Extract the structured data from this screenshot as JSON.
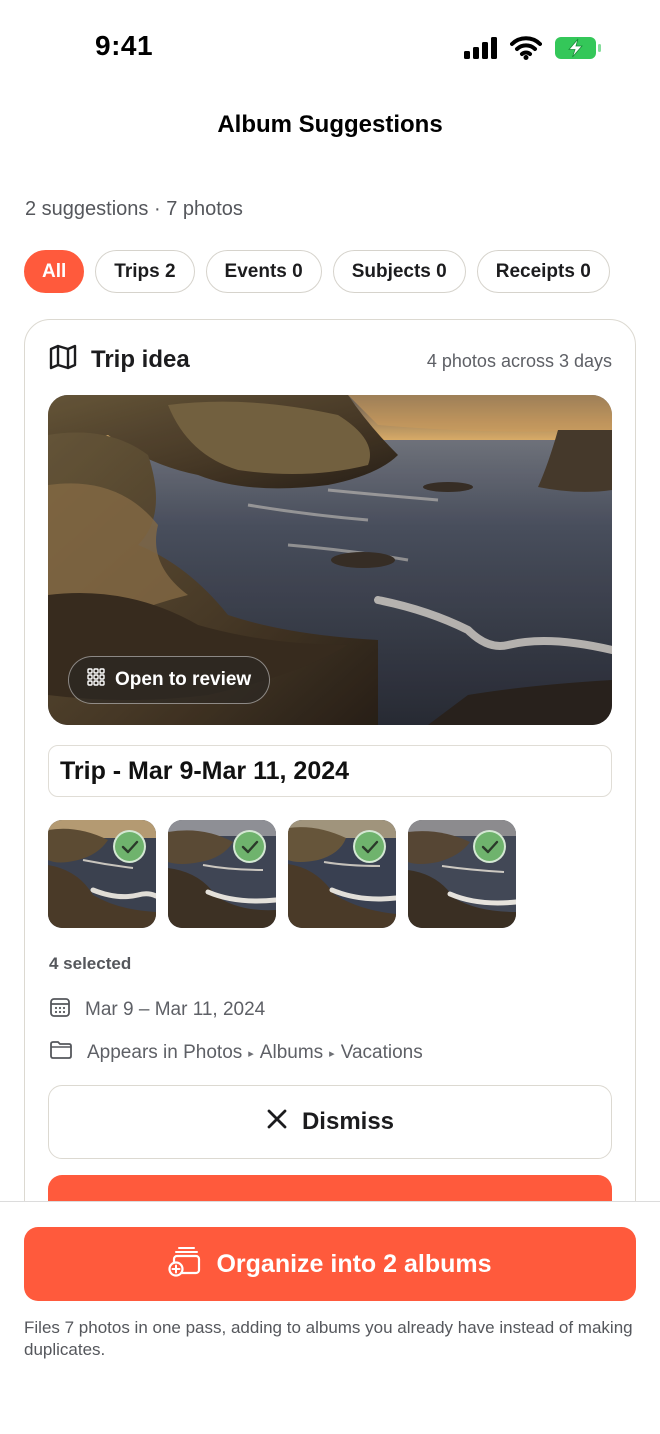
{
  "status": {
    "time": "9:41"
  },
  "nav": {
    "title": "Album Suggestions"
  },
  "summary": "2 suggestions · 7 photos",
  "filters": [
    {
      "label": "All"
    },
    {
      "label": "Trips 2"
    },
    {
      "label": "Events 0"
    },
    {
      "label": "Subjects 0"
    },
    {
      "label": "Receipts 0"
    }
  ],
  "card": {
    "title": "Trip idea",
    "meta": "4 photos across 3 days",
    "review_label": "Open to review",
    "album_name": "Trip - Mar 9-Mar 11, 2024",
    "selected_label": "4 selected",
    "date_range": "Mar 9 – Mar 11, 2024",
    "path": {
      "prefix": "Appears in Photos",
      "middle": "Albums",
      "last": "Vacations"
    },
    "dismiss_label": "Dismiss"
  },
  "footer": {
    "organize_label": "Organize into 2 albums",
    "note": "Files 7 photos in one pass, adding to albums you already have instead of making duplicates."
  },
  "colors": {
    "accent": "#ff5a3c",
    "check": "#6fb36d",
    "battery": "#34c759"
  }
}
